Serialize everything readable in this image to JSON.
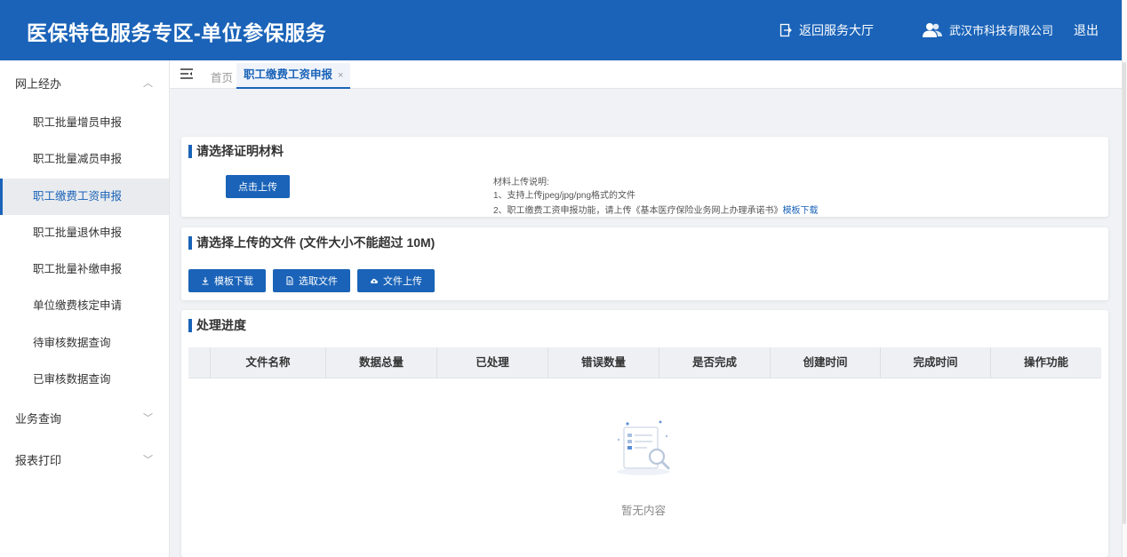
{
  "header": {
    "title": "医保特色服务专区-单位参保服务",
    "back_label": "返回服务大厅",
    "company": "武汉市科技有限公司",
    "logout": "退出"
  },
  "sidebar": {
    "groups": [
      {
        "label": "网上经办",
        "expanded": true,
        "items": [
          {
            "label": "职工批量增员申报"
          },
          {
            "label": "职工批量减员申报"
          },
          {
            "label": "职工缴费工资申报",
            "active": true
          },
          {
            "label": "职工批量退休申报"
          },
          {
            "label": "职工批量补缴申报"
          },
          {
            "label": "单位缴费核定申请"
          },
          {
            "label": "待审核数据查询"
          },
          {
            "label": "已审核数据查询"
          }
        ]
      },
      {
        "label": "业务查询",
        "expanded": false
      },
      {
        "label": "报表打印",
        "expanded": false
      }
    ]
  },
  "tabs": {
    "home": "首页",
    "active": "职工缴费工资申报",
    "close": "×"
  },
  "proof": {
    "title": "请选择证明材料",
    "upload_button": "点击上传",
    "notes_title": "材料上传说明:",
    "note1": "1、支持上传jpeg/jpg/png格式的文件",
    "note2": "2、职工缴费工资申报功能，请上传《基本医疗保险业务网上办理承诺书》",
    "note2_link": "模板下载"
  },
  "file_upload": {
    "title": "请选择上传的文件 (文件大小不能超过 10M)",
    "btn_template": "模板下载",
    "btn_select": "选取文件",
    "btn_upload": "文件上传"
  },
  "progress": {
    "title": "处理进度",
    "columns": [
      "",
      "文件名称",
      "数据总量",
      "已处理",
      "错误数量",
      "是否完成",
      "创建时间",
      "完成时间",
      "操作功能"
    ],
    "empty_text": "暂无内容"
  },
  "colors": {
    "primary": "#1a63b8",
    "background": "#f0f2f5"
  }
}
